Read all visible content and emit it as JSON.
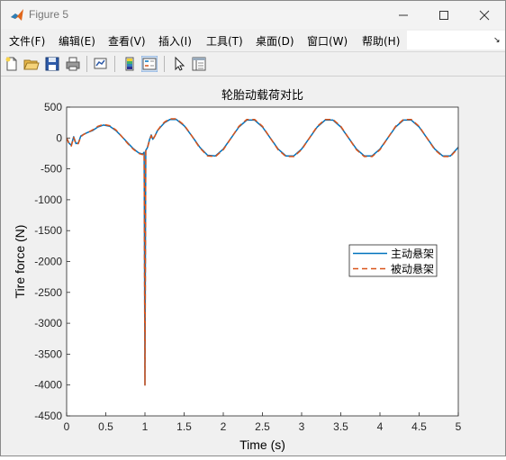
{
  "window": {
    "title": "Figure 5",
    "minimize": "minimize",
    "maximize": "maximize",
    "close": "close"
  },
  "menu": {
    "items": [
      "文件(F)",
      "编辑(E)",
      "查看(V)",
      "插入(I)",
      "工具(T)",
      "桌面(D)",
      "窗口(W)",
      "帮助(H)"
    ],
    "overflow_arrow": "↘"
  },
  "toolbar": {
    "icons": [
      "new-figure-icon",
      "open-file-icon",
      "save-icon",
      "print-icon",
      "link-plot-icon",
      "insert-colorbar-icon",
      "insert-legend-icon",
      "edit-plot-icon",
      "property-inspector-icon"
    ]
  },
  "colors": {
    "series_active": "#0072BD",
    "series_passive": "#D95319",
    "axes_bg": "#ffffff",
    "figure_bg": "#f0f0f0"
  },
  "chart_data": {
    "type": "line",
    "title": "轮胎动载荷对比",
    "xlabel": "Time (s)",
    "ylabel": "Tire force (N)",
    "xlim": [
      0,
      5
    ],
    "ylim": [
      -4500,
      500
    ],
    "xticks": [
      0,
      0.5,
      1,
      1.5,
      2,
      2.5,
      3,
      3.5,
      4,
      4.5,
      5
    ],
    "xtick_labels": [
      "0",
      "0.5",
      "1",
      "1.5",
      "2",
      "2.5",
      "3",
      "3.5",
      "4",
      "4.5",
      "5"
    ],
    "yticks": [
      500,
      0,
      -500,
      -1000,
      -1500,
      -2000,
      -2500,
      -3000,
      -3500,
      -4000,
      -4500
    ],
    "ytick_labels": [
      "500",
      "0",
      "-500",
      "-1000",
      "-1500",
      "-2000",
      "-2500",
      "-3000",
      "-3500",
      "-4000",
      "-4500"
    ],
    "grid": false,
    "legend_position": "right",
    "series": [
      {
        "name": "主动悬架",
        "style": "solid",
        "color": "#0072BD",
        "x": [
          0,
          0.03,
          0.06,
          0.09,
          0.12,
          0.15,
          0.18,
          0.22,
          0.27,
          0.33,
          0.4,
          0.47,
          0.55,
          0.63,
          0.7,
          0.78,
          0.85,
          0.92,
          0.97,
          0.99,
          1.0,
          1.01,
          1.03,
          1.06,
          1.08,
          1.1,
          1.13,
          1.16,
          1.2,
          1.25,
          1.32,
          1.4,
          1.5,
          1.6,
          1.7,
          1.8,
          1.9,
          2.0,
          2.1,
          2.2,
          2.3,
          2.4,
          2.5,
          2.6,
          2.7,
          2.8,
          2.9,
          3.0,
          3.1,
          3.2,
          3.3,
          3.4,
          3.5,
          3.6,
          3.7,
          3.8,
          3.9,
          4.0,
          4.1,
          4.2,
          4.3,
          4.4,
          4.5,
          4.6,
          4.7,
          4.8,
          4.9,
          5.0
        ],
        "y": [
          0,
          -80,
          -120,
          20,
          -90,
          -80,
          30,
          60,
          90,
          120,
          180,
          210,
          190,
          120,
          30,
          -80,
          -170,
          -240,
          -260,
          -230,
          -4000,
          -200,
          -160,
          -20,
          50,
          -20,
          40,
          120,
          180,
          250,
          300,
          300,
          200,
          30,
          -150,
          -280,
          -290,
          -180,
          0,
          180,
          290,
          290,
          180,
          0,
          -180,
          -290,
          -290,
          -180,
          0,
          180,
          290,
          290,
          180,
          0,
          -180,
          -290,
          -290,
          -180,
          0,
          180,
          290,
          290,
          180,
          0,
          -180,
          -290,
          -290,
          -150
        ]
      },
      {
        "name": "被动悬架",
        "style": "dashed",
        "color": "#D95319",
        "x": [
          0,
          0.03,
          0.06,
          0.09,
          0.12,
          0.15,
          0.18,
          0.22,
          0.27,
          0.33,
          0.4,
          0.47,
          0.55,
          0.63,
          0.7,
          0.78,
          0.85,
          0.92,
          0.97,
          0.99,
          1.0,
          1.01,
          1.03,
          1.06,
          1.08,
          1.1,
          1.13,
          1.16,
          1.2,
          1.25,
          1.32,
          1.4,
          1.5,
          1.6,
          1.7,
          1.8,
          1.9,
          2.0,
          2.1,
          2.2,
          2.3,
          2.4,
          2.5,
          2.6,
          2.7,
          2.8,
          2.9,
          3.0,
          3.1,
          3.2,
          3.3,
          3.4,
          3.5,
          3.6,
          3.7,
          3.8,
          3.9,
          4.0,
          4.1,
          4.2,
          4.3,
          4.4,
          4.5,
          4.6,
          4.7,
          4.8,
          4.9,
          5.0
        ],
        "y": [
          0,
          -90,
          -130,
          10,
          -100,
          -90,
          20,
          60,
          90,
          130,
          190,
          220,
          200,
          130,
          30,
          -90,
          -180,
          -250,
          -270,
          -240,
          -4000,
          -210,
          -170,
          -30,
          40,
          -30,
          40,
          120,
          190,
          260,
          310,
          310,
          210,
          30,
          -160,
          -290,
          -300,
          -190,
          0,
          190,
          300,
          300,
          190,
          0,
          -190,
          -300,
          -300,
          -190,
          0,
          190,
          300,
          300,
          190,
          0,
          -190,
          -300,
          -300,
          -190,
          0,
          190,
          300,
          300,
          190,
          0,
          -190,
          -300,
          -300,
          -160
        ]
      }
    ]
  }
}
